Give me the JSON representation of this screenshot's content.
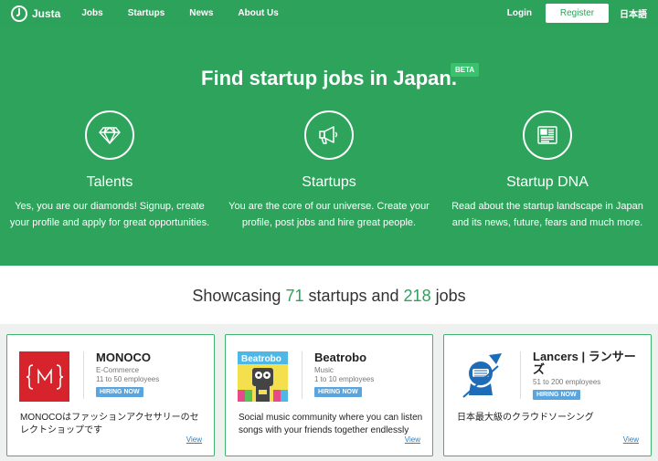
{
  "nav": {
    "brand": "Justa",
    "links": [
      "Jobs",
      "Startups",
      "News",
      "About Us"
    ],
    "login": "Login",
    "register": "Register",
    "language": "日本語"
  },
  "hero": {
    "title": "Find startup jobs in Japan.",
    "badge": "BETA",
    "features": [
      {
        "icon": "diamond-icon",
        "title": "Talents",
        "text": "Yes, you are our diamonds! Signup, create your profile and apply for great opportunities."
      },
      {
        "icon": "megaphone-icon",
        "title": "Startups",
        "text": "You are the core of our universe. Create your profile, post jobs and hire great people."
      },
      {
        "icon": "newspaper-icon",
        "title": "Startup DNA",
        "text": "Read about the startup landscape in Japan and its news, future, fears and much more."
      }
    ]
  },
  "stats": {
    "prefix": "Showcasing ",
    "startups": "71",
    "middle": " startups and ",
    "jobs": "218",
    "suffix": " jobs"
  },
  "cards": [
    {
      "name": "MONOCO",
      "category": "E-Commerce",
      "size": "11 to 50 employees",
      "badge": "HIRING NOW",
      "description": "MONOCOはファッションアクセサリーのセレクトショップです",
      "view": "View"
    },
    {
      "name": "Beatrobo",
      "category": "Music",
      "size": "1 to 10 employees",
      "badge": "HIRING NOW",
      "description": "Social music community where you can listen songs with your friends together endlessly",
      "view": "View"
    },
    {
      "name": "Lancers | ランサーズ",
      "category": "",
      "size": "51 to 200 employees",
      "badge": "HIRING NOW",
      "description": "日本最大級のクラウドソーシング",
      "view": "View"
    }
  ],
  "colors": {
    "brand": "#2ca25a",
    "accent": "#5aa5dd",
    "monoco": "#d7242c"
  }
}
